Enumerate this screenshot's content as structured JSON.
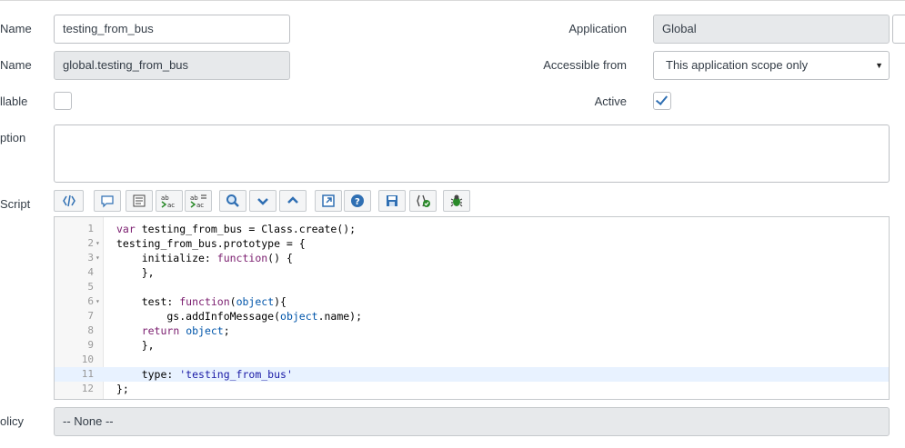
{
  "form": {
    "name_label": "Name",
    "name_value": "testing_from_bus",
    "api_name_label": "Name",
    "api_name_value": "global.testing_from_bus",
    "callable_label": "llable",
    "description_label": "ption",
    "script_label": "Script",
    "policy_label": "olicy",
    "policy_value": "-- None --",
    "application_label": "Application",
    "application_value": "Global",
    "accessible_label": "Accessible from",
    "accessible_value": "This application scope only",
    "active_label": "Active",
    "active_checked": true,
    "callable_checked": false
  },
  "toolbar": {
    "buttons": [
      {
        "icon": "format-code-icon"
      },
      {
        "icon": "comment-icon"
      },
      {
        "icon": "format-lines-icon"
      },
      {
        "icon": "replace-icon"
      },
      {
        "icon": "replace-all-icon"
      },
      {
        "icon": "search-icon"
      },
      {
        "icon": "chevron-down-icon"
      },
      {
        "icon": "chevron-up-icon"
      },
      {
        "icon": "fullscreen-icon"
      },
      {
        "icon": "help-icon"
      },
      {
        "icon": "save-icon"
      },
      {
        "icon": "validate-icon"
      },
      {
        "icon": "debug-icon"
      }
    ]
  },
  "editor": {
    "active_line": 11,
    "lines": [
      {
        "n": "1",
        "fold": "",
        "text": "var testing_from_bus = Class.create();"
      },
      {
        "n": "2",
        "fold": "▾",
        "text": "testing_from_bus.prototype = {"
      },
      {
        "n": "3",
        "fold": "▾",
        "text": "    initialize: function() {"
      },
      {
        "n": "4",
        "fold": "",
        "text": "    },"
      },
      {
        "n": "5",
        "fold": "",
        "text": ""
      },
      {
        "n": "6",
        "fold": "▾",
        "text": "    test: function(object){"
      },
      {
        "n": "7",
        "fold": "",
        "text": "        gs.addInfoMessage(object.name);"
      },
      {
        "n": "8",
        "fold": "",
        "text": "    return object;"
      },
      {
        "n": "9",
        "fold": "",
        "text": "    },"
      },
      {
        "n": "10",
        "fold": "",
        "text": ""
      },
      {
        "n": "11",
        "fold": "",
        "text": "    type: 'testing_from_bus'"
      },
      {
        "n": "12",
        "fold": "",
        "text": "};"
      }
    ]
  },
  "colors": {
    "accent": "#2f6fb3",
    "readonly_bg": "#e7e9eb"
  }
}
